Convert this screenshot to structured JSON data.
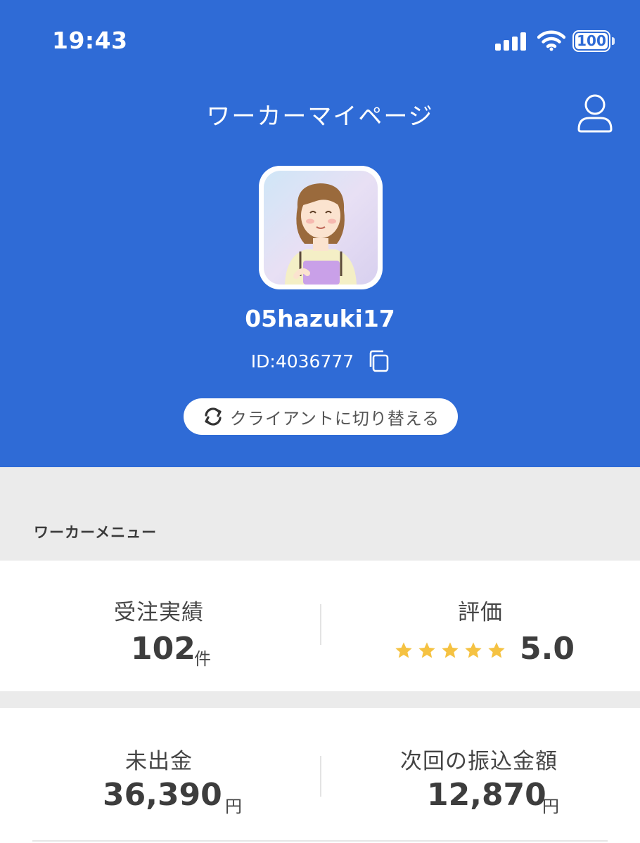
{
  "status_bar": {
    "time": "19:43",
    "battery": "100"
  },
  "header": {
    "title": "ワーカーマイページ"
  },
  "profile": {
    "username": "05hazuki17",
    "user_id": "ID:4036777",
    "switch_label": "クライアントに切り替える"
  },
  "worker_menu": {
    "section_label": "ワーカーメニュー",
    "orders": {
      "title": "受注実績",
      "value": "102",
      "unit": "件"
    },
    "rating": {
      "title": "評価",
      "value": "5.0",
      "stars": 5
    },
    "unpaid": {
      "title": "未出金",
      "value": "36,390",
      "unit": "円"
    },
    "next_transfer": {
      "title": "次回の振込金額",
      "value": "12,870",
      "unit": "円"
    }
  },
  "colors": {
    "header_bg": "#2f6bd6",
    "star": "#f5c242",
    "page_bg": "#ebebeb"
  }
}
